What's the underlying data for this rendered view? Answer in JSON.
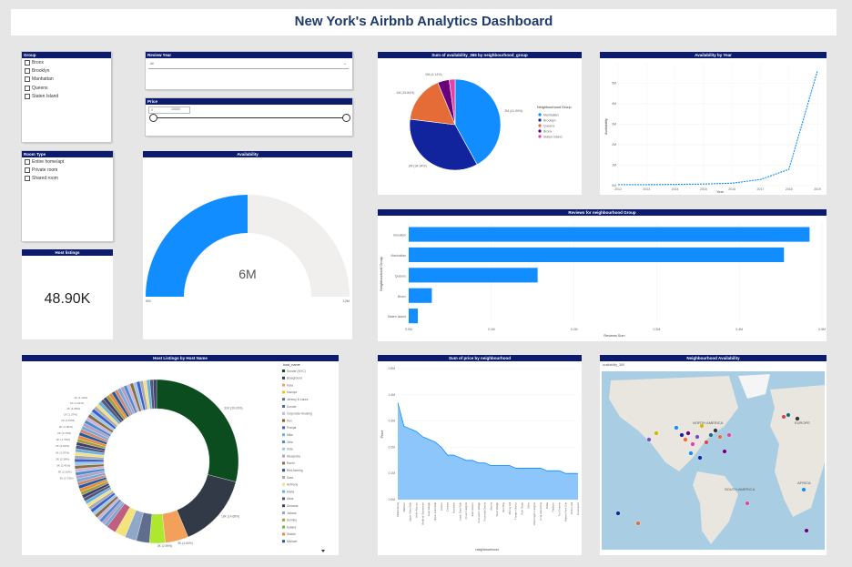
{
  "title": "New York's Airbnb Analytics Dashboard",
  "colors": {
    "header": "#0d1b6e",
    "blue": "#118dff",
    "navy": "#12239e",
    "orange": "#e66c37",
    "purple": "#6b007b",
    "pink": "#e044a7",
    "light_gray": "#f0efee"
  },
  "slicer_group": {
    "title": "Group",
    "items": [
      "Bronx",
      "Brooklyn",
      "Manhattan",
      "Queens",
      "Staten Island"
    ]
  },
  "slicer_year": {
    "title": "Review Year",
    "value": "All"
  },
  "slicer_price": {
    "title": "Price",
    "min": "0",
    "max": "10000"
  },
  "slicer_room": {
    "title": "Room Type",
    "items": [
      "Entire home/apt",
      "Private room",
      "Shared room"
    ]
  },
  "host_listings_card": {
    "title": "Host listings",
    "value": "48.90K"
  },
  "availability_gauge": {
    "title": "Availability",
    "value": "6M",
    "min_label": "0M",
    "max_label": "12M",
    "fraction": 0.5
  },
  "pie_chart": {
    "title": "Sum of availability_365 by neighbourhood_group",
    "legend_title": "Neighbourhood Group",
    "chart_data": {
      "type": "pie",
      "series": [
        {
          "name": "Manhattan",
          "label": "2M (41.99%)",
          "value": 41.99,
          "color": "#118dff"
        },
        {
          "name": "Brooklyn",
          "label": "2M (34.94%)",
          "value": 34.94,
          "color": "#12239e"
        },
        {
          "name": "Queens",
          "label": "1M (16.84%)",
          "value": 16.84,
          "color": "#e66c37"
        },
        {
          "name": "Bronx",
          "label": "0M (4.14%)",
          "value": 4.14,
          "color": "#6b007b"
        },
        {
          "name": "Staten Island",
          "label": "",
          "value": 2.09,
          "color": "#e044a7"
        }
      ]
    }
  },
  "line_chart": {
    "title": "Availability by Year",
    "ylabel": "Availability",
    "xlabel": "Year",
    "chart_data": {
      "type": "line",
      "x": [
        "2012",
        "2013",
        "2014",
        "2015",
        "2016",
        "2017",
        "2018",
        "2019"
      ],
      "y": [
        0.05,
        0.05,
        0.06,
        0.08,
        0.12,
        0.3,
        0.8,
        5.6
      ],
      "y_ticks": [
        "0M",
        "1M",
        "2M",
        "3M",
        "4M",
        "5M"
      ],
      "ylim": [
        0,
        6
      ]
    }
  },
  "bar_chart": {
    "title": "Reviews for neighbourhood Group",
    "ylabel": "Neighbourhood Group",
    "xlabel": "Reviews Sum",
    "chart_data": {
      "type": "bar",
      "categories": [
        "Brooklyn",
        "Manhattan",
        "Queens",
        "Bronx",
        "Staten Island"
      ],
      "values": [
        0.485,
        0.454,
        0.156,
        0.028,
        0.011
      ],
      "x_ticks": [
        "0.0M",
        "0.1M",
        "0.2M",
        "0.3M",
        "0.4M",
        "0.5M"
      ],
      "xlim": [
        0,
        0.5
      ]
    }
  },
  "donut_chart": {
    "title": "Host Listings by Host Name",
    "legend_title": "host_name",
    "legend_items": [
      {
        "name": "Sonder (NYC)",
        "color": "#0b4d1f"
      },
      {
        "name": "Blueground",
        "color": "#333a47"
      },
      {
        "name": "Kara",
        "color": "#f2a05a"
      },
      {
        "name": "Kazuya",
        "color": "#f2c811"
      },
      {
        "name": "Jeremy & Laura",
        "color": "#5e6e8c"
      },
      {
        "name": "Sonder",
        "color": "#4a6fa5"
      },
      {
        "name": "Corporate Housing",
        "color": "#c9b3e0"
      },
      {
        "name": "Ken",
        "color": "#8b5a2b"
      },
      {
        "name": "Pranjal",
        "color": "#3a5fcd"
      },
      {
        "name": "Mike",
        "color": "#7aa7d6"
      },
      {
        "name": "John",
        "color": "#4e8cc7"
      },
      {
        "name": "Vida",
        "color": "#9dc8e8"
      },
      {
        "name": "Alexandra",
        "color": "#b0a0c8"
      },
      {
        "name": "Rachi",
        "color": "#8c6d3e"
      },
      {
        "name": "Red Awning",
        "color": "#2a4d9f"
      },
      {
        "name": "Sara",
        "color": "#aaaaaa"
      },
      {
        "name": "Anthony",
        "color": "#f0e08c"
      },
      {
        "name": "Maria",
        "color": "#6cb0e0"
      },
      {
        "name": "Alina",
        "color": "#50597a"
      },
      {
        "name": "Amanda",
        "color": "#3f3f6e"
      },
      {
        "name": "Juliana",
        "color": "#8fa8c8"
      },
      {
        "name": "Sumley",
        "color": "#a0a040"
      },
      {
        "name": "Eyland",
        "color": "#7cb342"
      },
      {
        "name": "Staicie",
        "color": "#e98a3c"
      },
      {
        "name": "Michael",
        "color": "#1f5b9e"
      }
    ],
    "chart_data": {
      "type": "pie",
      "series": [
        {
          "name": "Sonder (NYC)",
          "value": 29.03,
          "label": "32K (29.03%)",
          "color": "#0b4d1f"
        },
        {
          "name": "Blueground",
          "value": 14.68,
          "label": "16K (14.68%)",
          "color": "#333a47"
        },
        {
          "name": "Kara",
          "value": 4.6,
          "label": "5K (4.60%)",
          "color": "#f2a05a"
        },
        {
          "name": "Kazuya",
          "value": 3.1,
          "label": "3K (2.99%)",
          "color": "#aee82e"
        },
        {
          "name": "Jeremy & Laura",
          "value": 2.6,
          "label": "",
          "color": "#5e6e8c"
        },
        {
          "name": "Sonder",
          "value": 2.3,
          "label": "",
          "color": "#8fa8c8"
        },
        {
          "name": "Corporate Housing",
          "value": 2.1,
          "label": "",
          "color": "#f2e37a"
        },
        {
          "name": "Ken",
          "value": 1.9,
          "label": "",
          "color": "#c06080"
        }
      ],
      "other_labels": [
        "3K (2.75%)",
        "3K (2.61%)",
        "3K (2.41%)",
        "2K (2.18%)",
        "2K (1.97%)",
        "2K (1.82%)",
        "2K (1.73%)",
        "2K (1.70%)",
        "2K (1.60%)",
        "2K (1.54%)",
        "1K (1.37%)",
        "1K (1.26%)",
        "1K (1.21%)",
        "1K (1.14%)"
      ]
    }
  },
  "area_chart": {
    "title": "Sum of price by neighbourhood",
    "ylabel": "Price",
    "xlabel": "neighbourhood",
    "chart_data": {
      "type": "area",
      "categories": [
        "Williamsburg",
        "Midtown",
        "Upper West Side",
        "Hell's Kitchen",
        "Bedford-Stuyvesant",
        "East Village",
        "Upper East Side",
        "Harlem",
        "Chelsea",
        "Bushwick",
        "Lower East Side",
        "Crown Heights",
        "East Harlem",
        "Greenwich Village",
        "Financial District",
        "Astoria",
        "West Village",
        "Kips Bay",
        "Murray Hill",
        "Theater District",
        "Park Slope",
        "SoHo",
        "Washington Heights",
        "Long Island City",
        "Nolita",
        "Flatbush",
        "Fort Greene",
        "Battery Park City",
        "Clinton Hill",
        "Greenpoint"
      ],
      "values": [
        0.37,
        0.28,
        0.27,
        0.26,
        0.24,
        0.23,
        0.22,
        0.2,
        0.17,
        0.17,
        0.16,
        0.15,
        0.15,
        0.14,
        0.14,
        0.13,
        0.13,
        0.13,
        0.13,
        0.12,
        0.12,
        0.12,
        0.12,
        0.12,
        0.11,
        0.11,
        0.11,
        0.1,
        0.1,
        0.1
      ],
      "y_ticks": [
        "0.0M",
        "0.1M",
        "0.2M",
        "0.3M",
        "0.4M",
        "0.5M"
      ],
      "ylim": [
        0,
        0.5
      ]
    }
  },
  "map": {
    "title": "Neighbourhood Availability",
    "legend_label": "availability_365",
    "labels": {
      "north_america": "NORTH AMERICA",
      "south_america": "SOUTH AMERICA",
      "europe": "EUROPE",
      "africa": "AFRICA"
    }
  }
}
